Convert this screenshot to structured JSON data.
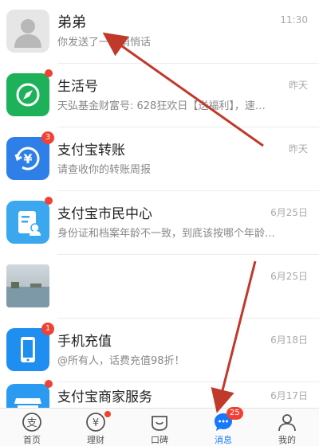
{
  "colors": {
    "accent": "#1677ff",
    "badge_red": "#f04134",
    "annotation_arrow": "#c0392b"
  },
  "conversations": [
    {
      "title": "弟弟",
      "preview": "你发送了一条悄悄话",
      "time": "11:30",
      "badge": "",
      "avatar": "person-placeholder-icon"
    },
    {
      "title": "生活号",
      "preview": "天弘基金财富号: 628狂欢日【送福利】，速…",
      "time": "昨天",
      "badge": "dot",
      "avatar": "compass-icon"
    },
    {
      "title": "支付宝转账",
      "preview": "请查收你的转账周报",
      "time": "昨天",
      "badge": "3",
      "avatar": "transfer-yuan-icon"
    },
    {
      "title": "支付宝市民中心",
      "preview": "身份证和档案年龄不一致，到底该按哪个年龄…",
      "time": "6月25日",
      "badge": "dot",
      "avatar": "citizen-card-icon"
    },
    {
      "title": "",
      "preview": "",
      "time": "6月25日",
      "badge": "",
      "avatar": "photo-thumbnail"
    },
    {
      "title": "手机充值",
      "preview": "@所有人，话费充值98折！",
      "time": "6月18日",
      "badge": "1",
      "avatar": "phone-icon"
    },
    {
      "title": "支付宝商家服务",
      "preview": "",
      "time": "6月17日",
      "badge": "dot",
      "avatar": "store-icon"
    }
  ],
  "tabbar": {
    "tabs": [
      {
        "label": "首页",
        "icon": "alipay-home-icon",
        "badge": ""
      },
      {
        "label": "理财",
        "icon": "wealth-yuan-icon",
        "badge": "dot"
      },
      {
        "label": "口碑",
        "icon": "koubei-icon",
        "badge": ""
      },
      {
        "label": "消息",
        "icon": "message-bubble-icon",
        "badge": "25"
      },
      {
        "label": "我的",
        "icon": "profile-icon",
        "badge": ""
      }
    ],
    "active": "消息"
  }
}
